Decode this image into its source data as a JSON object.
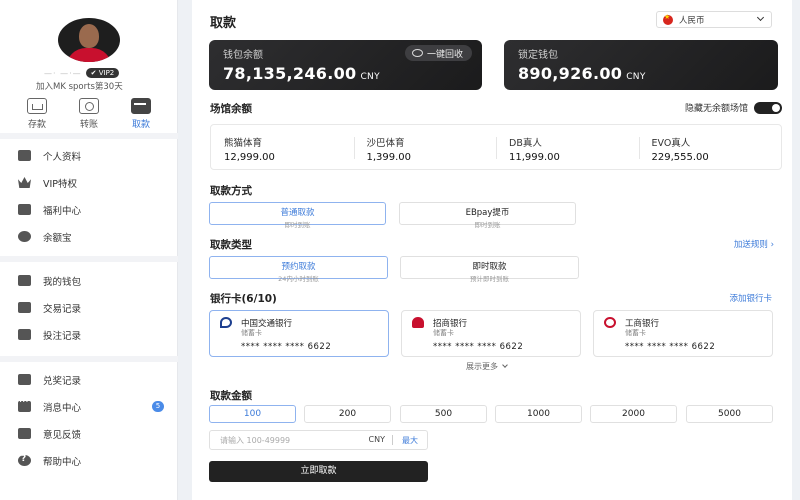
{
  "user": {
    "name_masked": "—·  —·—",
    "vip_level": "VIP2",
    "join_text": "加入MK sports第30天"
  },
  "quick_tabs": [
    {
      "label": "存款",
      "icon": "deposit-icon"
    },
    {
      "label": "转账",
      "icon": "transfer-icon"
    },
    {
      "label": "取款",
      "icon": "withdraw-icon",
      "active": true
    }
  ],
  "menu": {
    "group1": [
      {
        "label": "个人资料",
        "icon": "id-card-icon"
      },
      {
        "label": "VIP特权",
        "icon": "crown-icon"
      },
      {
        "label": "福利中心",
        "icon": "gift-icon"
      },
      {
        "label": "余额宝",
        "icon": "treasure-icon"
      }
    ],
    "group2": [
      {
        "label": "我的钱包",
        "icon": "wallet-icon"
      },
      {
        "label": "交易记录",
        "icon": "transaction-icon"
      },
      {
        "label": "投注记录",
        "icon": "bet-record-icon"
      }
    ],
    "group3": [
      {
        "label": "兑奖记录",
        "icon": "redeem-icon"
      },
      {
        "label": "消息中心",
        "icon": "chat-icon",
        "badge": "5"
      },
      {
        "label": "意见反馈",
        "icon": "feedback-icon"
      },
      {
        "label": "帮助中心",
        "icon": "help-icon"
      }
    ]
  },
  "page": {
    "title": "取款",
    "currency": "人民币"
  },
  "wallets": {
    "balance": {
      "label": "钱包余额",
      "amount": "78,135,246.00",
      "unit": "CNY",
      "recycle_label": "一键回收"
    },
    "locked": {
      "label": "锁定钱包",
      "amount": "890,926.00",
      "unit": "CNY"
    }
  },
  "venues": {
    "title": "场馆余额",
    "hide_empty_label": "隐藏无余额场馆",
    "hide_empty_on": true,
    "items": [
      {
        "name": "熊猫体育",
        "amount": "12,999.00"
      },
      {
        "name": "沙巴体育",
        "amount": "1,399.00"
      },
      {
        "name": "DB真人",
        "amount": "11,999.00"
      },
      {
        "name": "EVO真人",
        "amount": "229,555.00"
      }
    ]
  },
  "withdraw_method": {
    "title": "取款方式",
    "options": [
      {
        "title": "普通取款",
        "sub": "即时到账",
        "selected": true
      },
      {
        "title": "EBpay提币",
        "sub": "即时到账",
        "selected": false
      }
    ]
  },
  "withdraw_type": {
    "title": "取款类型",
    "rules_link": "加送规则",
    "options": [
      {
        "title": "预约取款",
        "sub": "24内小时到账",
        "selected": true
      },
      {
        "title": "即时取款",
        "sub": "预计即时到账",
        "selected": false
      }
    ]
  },
  "bank_cards": {
    "title": "银行卡(6/10)",
    "add_link": "添加银行卡",
    "show_more": "展示更多",
    "cards": [
      {
        "name": "中国交通银行",
        "type": "储蓄卡",
        "number": "****   ****   ****   6622",
        "selected": true
      },
      {
        "name": "招商银行",
        "type": "储蓄卡",
        "number": "****   ****   ****   6622",
        "selected": false
      },
      {
        "name": "工商银行",
        "type": "储蓄卡",
        "number": "****   ****   ****   6622",
        "selected": false
      }
    ]
  },
  "amount": {
    "title": "取款金额",
    "presets": [
      "100",
      "200",
      "500",
      "1000",
      "2000",
      "5000"
    ],
    "selected_preset": "100",
    "placeholder": "请输入 100-49999",
    "unit": "CNY",
    "max_label": "最大",
    "submit_label": "立即取款"
  },
  "colors": {
    "accent": "#3d7bd9",
    "dark": "#222222",
    "selected_border": "#8fb3ef"
  }
}
